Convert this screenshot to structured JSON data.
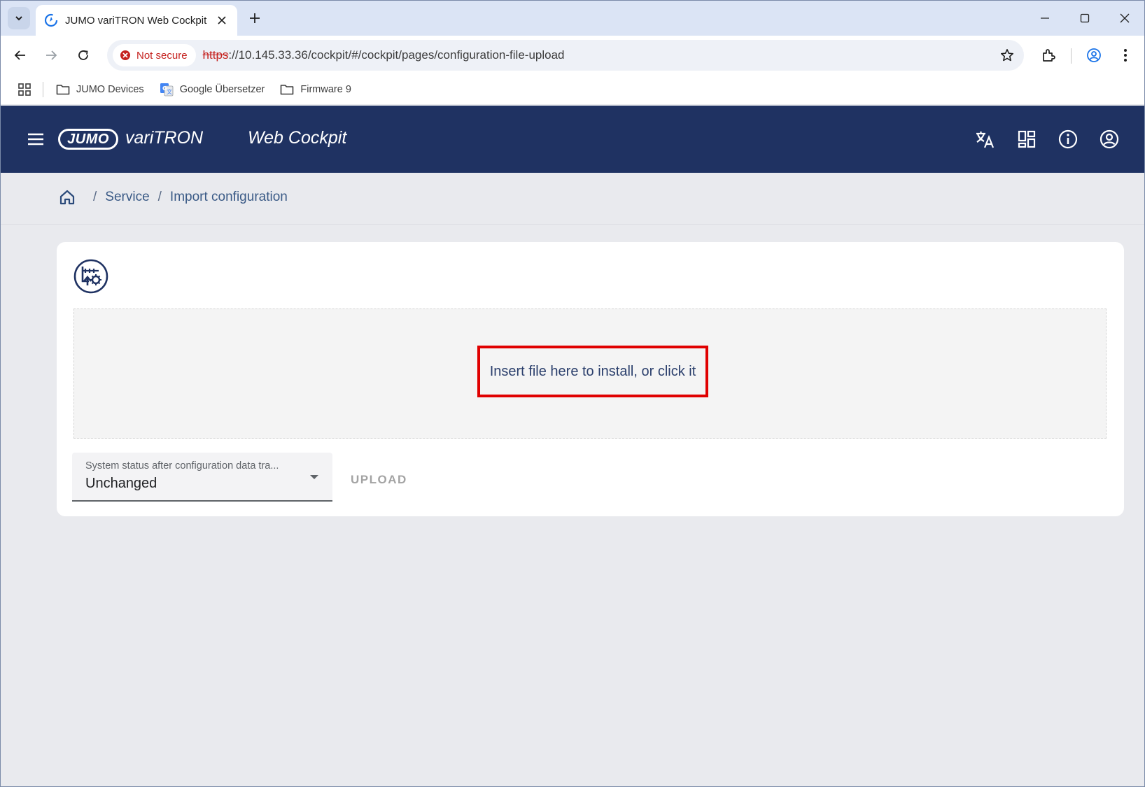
{
  "browser": {
    "tab_title": "JUMO variTRON Web Cockpit",
    "security_label": "Not secure",
    "url_scheme": "https",
    "url_rest": "://10.145.33.36/cockpit/#/cockpit/pages/configuration-file-upload",
    "bookmarks": [
      {
        "label": "JUMO Devices",
        "icon": "folder-icon"
      },
      {
        "label": "Google Übersetzer",
        "icon": "google-translate-icon"
      },
      {
        "label": "Firmware 9",
        "icon": "folder-icon"
      }
    ]
  },
  "app": {
    "logo_text": "JUMO",
    "product_name": "variTRON",
    "title": "Web Cockpit",
    "header_icons": [
      "translate-icon",
      "dashboard-icon",
      "info-icon",
      "account-icon"
    ],
    "colors": {
      "header_bg": "#1f3262",
      "highlight": "#e00000"
    }
  },
  "breadcrumb": {
    "items": [
      "Service",
      "Import configuration"
    ]
  },
  "upload_card": {
    "dropzone_text": "Insert file here to install, or click it",
    "select_label": "System status after configuration data tra...",
    "select_value": "Unchanged",
    "upload_label": "UPLOAD"
  }
}
